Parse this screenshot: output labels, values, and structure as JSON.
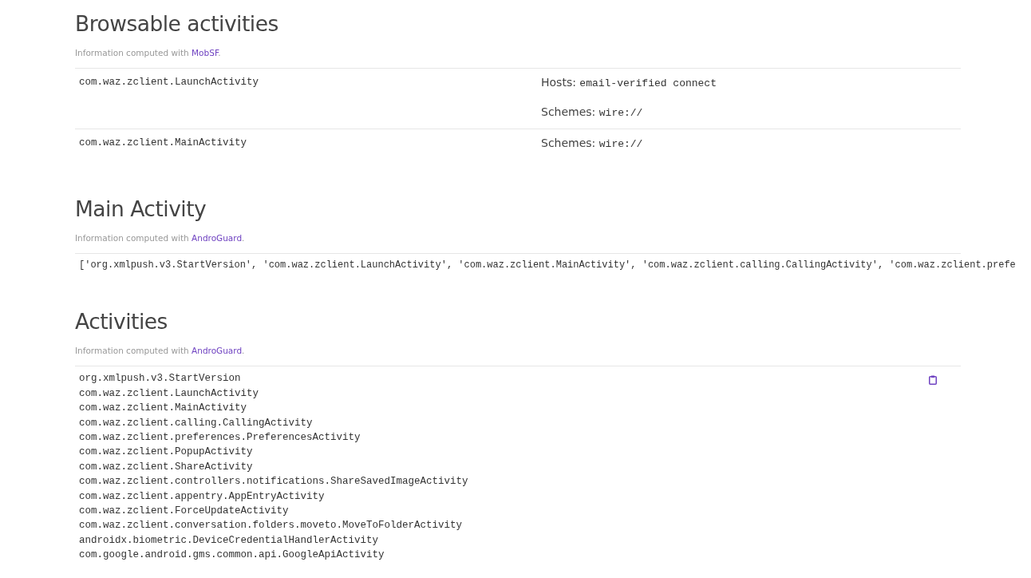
{
  "sections": [
    {
      "kind": "browsable",
      "title": "Browsable activities",
      "caption": "Information computed with",
      "source": "MobSF",
      "caption_end": ".",
      "rows": [
        {
          "activity": "com.waz.zclient.LaunchActivity",
          "details": [
            {
              "label": "Hosts:",
              "value": "email-verified connect"
            },
            {
              "label": "Schemes:",
              "value": "wire://"
            }
          ]
        },
        {
          "activity": "com.waz.zclient.MainActivity",
          "details": [
            {
              "label": "Schemes:",
              "value": "wire://"
            }
          ]
        }
      ]
    },
    {
      "kind": "line",
      "title": "Main Activity",
      "caption": "Information computed with",
      "source": "AndroGuard",
      "caption_end": ".",
      "text": "['org.xmlpush.v3.StartVersion', 'com.waz.zclient.LaunchActivity', 'com.waz.zclient.MainActivity', 'com.waz.zclient.calling.CallingActivity', 'com.waz.zclient.prefe"
    },
    {
      "kind": "list",
      "title": "Activities",
      "caption": "Information computed with",
      "source": "AndroGuard",
      "caption_end": ".",
      "items": [
        "org.xmlpush.v3.StartVersion",
        "com.waz.zclient.LaunchActivity",
        "com.waz.zclient.MainActivity",
        "com.waz.zclient.calling.CallingActivity",
        "com.waz.zclient.preferences.PreferencesActivity",
        "com.waz.zclient.PopupActivity",
        "com.waz.zclient.ShareActivity",
        "com.waz.zclient.controllers.notifications.ShareSavedImageActivity",
        "com.waz.zclient.appentry.AppEntryActivity",
        "com.waz.zclient.ForceUpdateActivity",
        "com.waz.zclient.conversation.folders.moveto.MoveToFolderActivity",
        "androidx.biometric.DeviceCredentialHandlerActivity",
        "com.google.android.gms.common.api.GoogleApiActivity"
      ]
    }
  ]
}
